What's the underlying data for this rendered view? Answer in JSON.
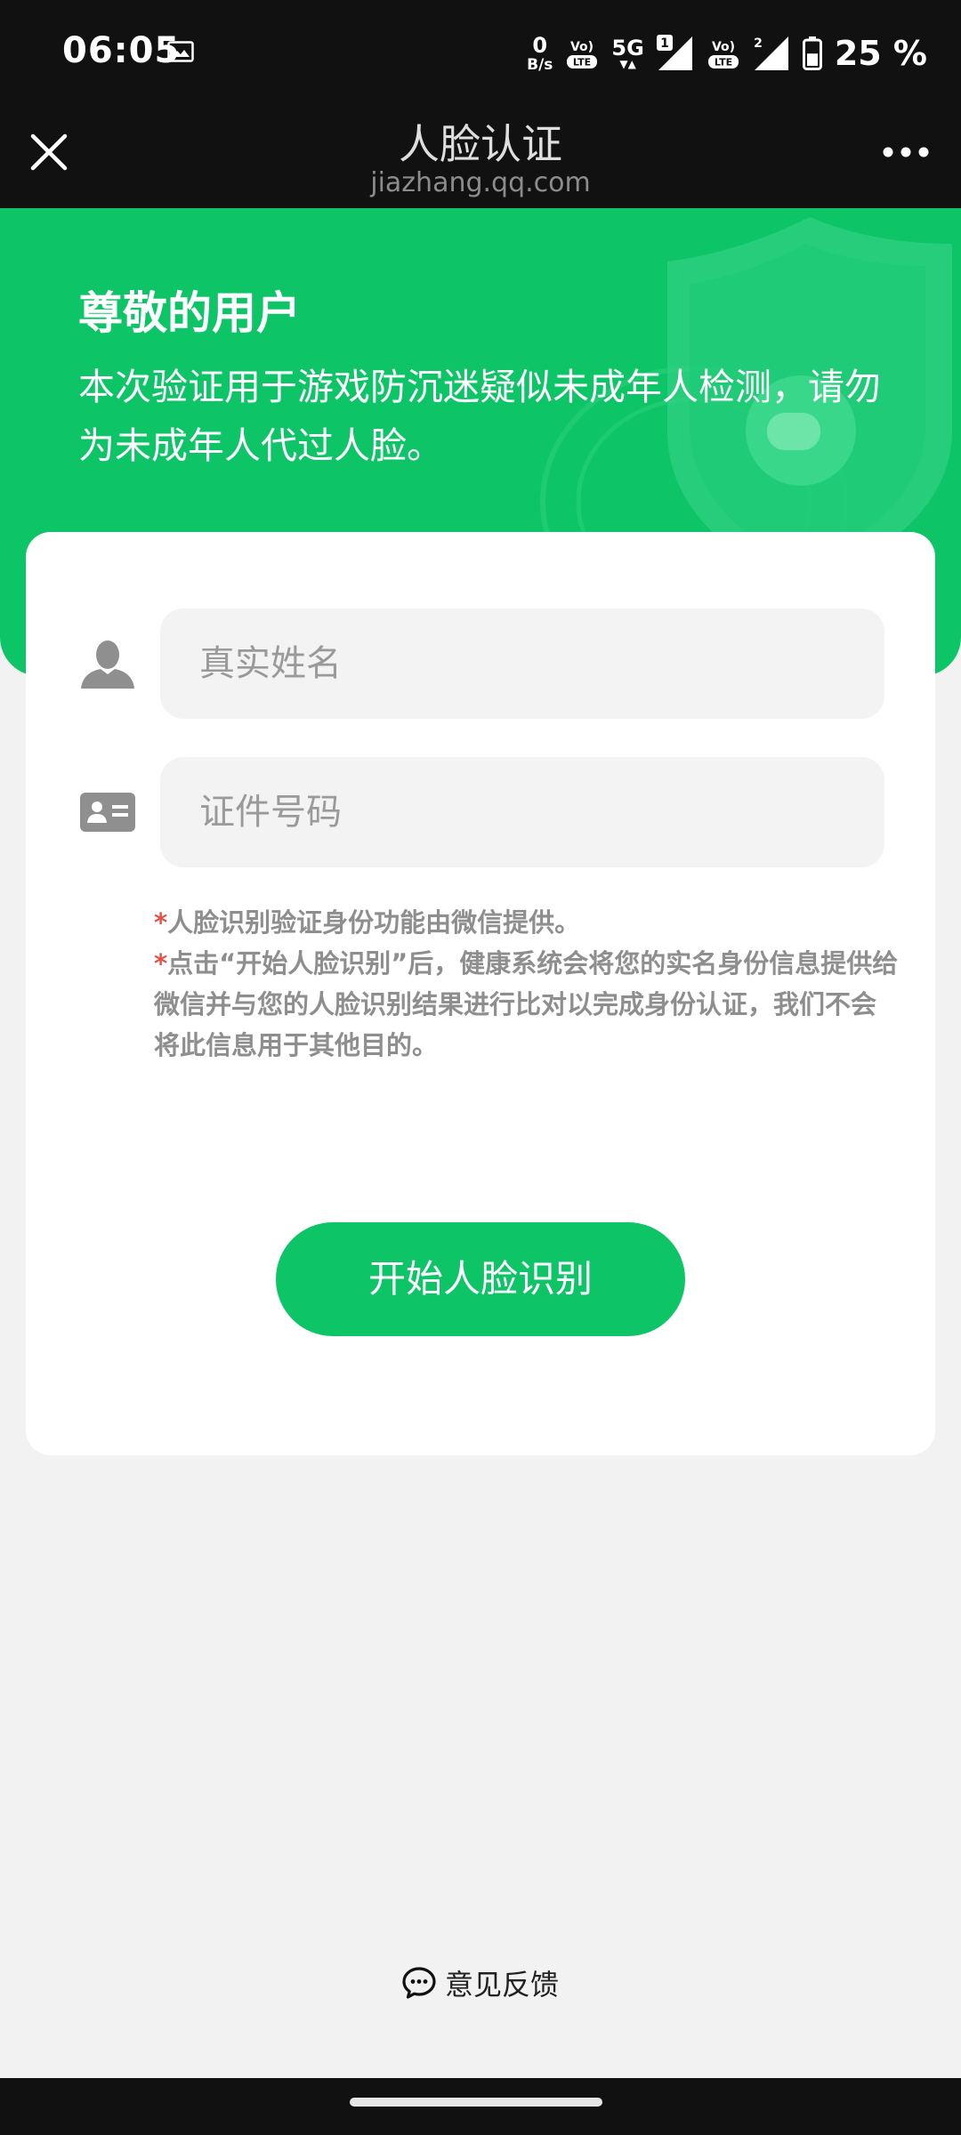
{
  "status_bar": {
    "time": "06:05",
    "net_speed_value": "0",
    "net_speed_unit": "B/s",
    "volte1": "LTE",
    "net_type": "5G",
    "sim1_badge": "1",
    "volte2": "LTE",
    "sim2_badge": "2",
    "battery": "25 %",
    "battery_percent": 25
  },
  "nav": {
    "title": "人脸认证",
    "domain": "jiazhang.qq.com"
  },
  "header": {
    "greeting": "尊敬的用户",
    "notice": "本次验证用于游戏防沉迷疑似未成年人检测，请勿为未成年人代过人脸。"
  },
  "form": {
    "name_placeholder": "真实姓名",
    "id_placeholder": "证件号码",
    "asterisk": "*",
    "note1": "人脸识别验证身份功能由微信提供。",
    "note2": "点击“开始人脸识别”后，健康系统会将您的实名身份信息提供给微信并与您的人脸识别结果进行比对以完成身份认证，我们不会将此信息用于其他目的。"
  },
  "start_button": "开始人脸识别",
  "feedback": "意见反馈",
  "colors": {
    "brand_green": "#0dc467",
    "bar_dark": "#111111",
    "asterisk_red": "#e0524a"
  },
  "icons": [
    "gallery-icon",
    "close-icon",
    "more-icon",
    "shield-icon",
    "user-icon",
    "id-card-icon",
    "chat-bubble-icon"
  ]
}
